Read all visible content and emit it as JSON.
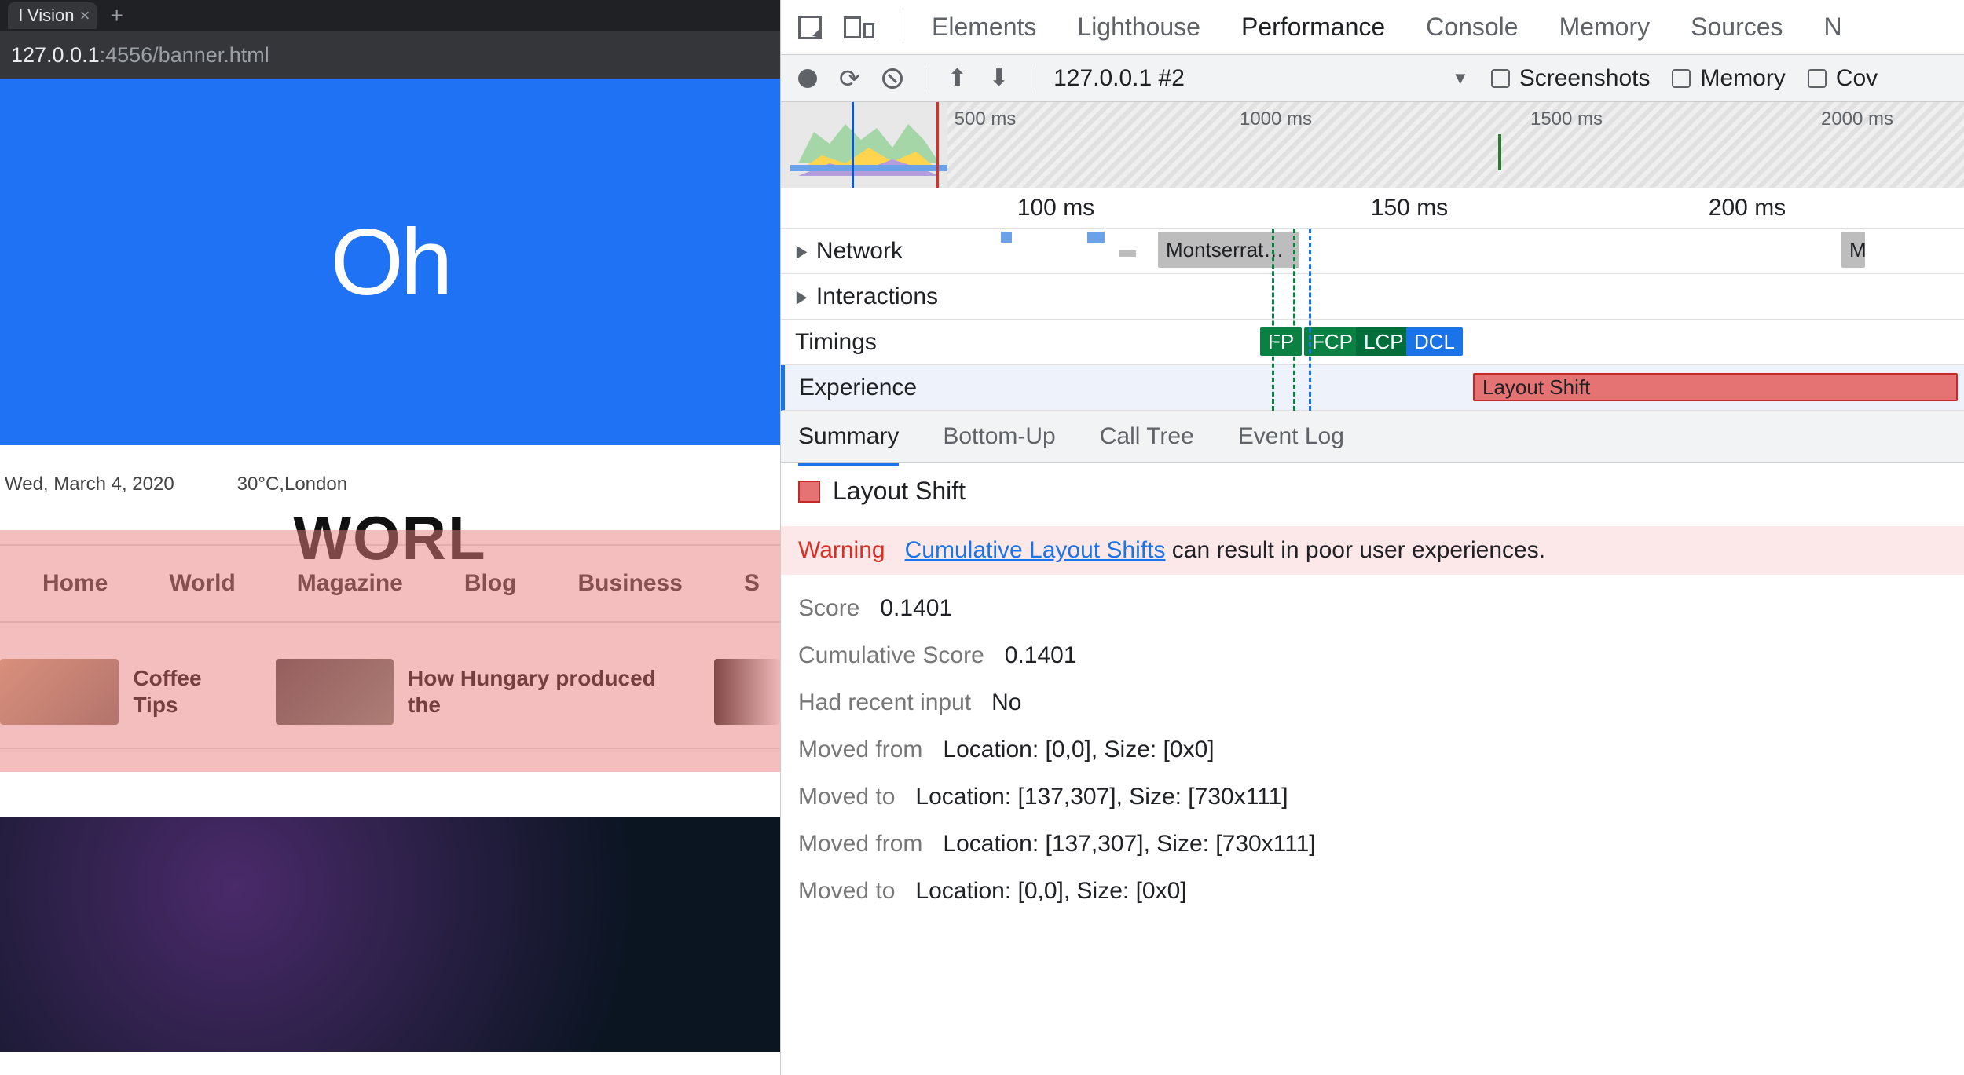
{
  "browser": {
    "tab_title": "l Vision",
    "url_host": "127.0.0.1",
    "url_rest": ":4556/banner.html"
  },
  "page": {
    "banner_text": "Oh",
    "date": "Wed, March 4, 2020",
    "weather": "30°C,London",
    "site_title": "WORL",
    "nav": [
      "Home",
      "World",
      "Magazine",
      "Blog",
      "Business",
      "S"
    ],
    "stories": [
      {
        "title": "Coffee Tips"
      },
      {
        "title": "How Hungary produced the"
      }
    ]
  },
  "devtools": {
    "tabs": [
      "Elements",
      "Lighthouse",
      "Performance",
      "Console",
      "Memory",
      "Sources",
      "N"
    ],
    "active_tab": "Performance",
    "toolbar": {
      "recording_select": "127.0.0.1 #2",
      "screenshots": "Screenshots",
      "memory": "Memory",
      "cov": "Cov"
    },
    "overview_ticks": [
      "500 ms",
      "1000 ms",
      "1500 ms",
      "2000 ms"
    ],
    "ruler_ticks": [
      "100 ms",
      "150 ms",
      "200 ms"
    ],
    "tracks": {
      "network": "Network",
      "network_chip": "Montserrat…",
      "network_chip2": "M",
      "interactions": "Interactions",
      "timings": "Timings",
      "timings_markers": {
        "fp": "FP",
        "fcp": "FCP",
        "lcp": "LCP",
        "dcl": "DCL"
      },
      "experience": "Experience",
      "experience_chip": "Layout Shift"
    },
    "subtabs": [
      "Summary",
      "Bottom-Up",
      "Call Tree",
      "Event Log"
    ],
    "active_subtab": "Summary",
    "detail": {
      "title": "Layout Shift",
      "warning_label": "Warning",
      "warning_link": "Cumulative Layout Shifts",
      "warning_rest": " can result in poor user experiences.",
      "rows": [
        {
          "k": "Score",
          "v": "0.1401"
        },
        {
          "k": "Cumulative Score",
          "v": "0.1401"
        },
        {
          "k": "Had recent input",
          "v": "No"
        },
        {
          "k": "Moved from",
          "v": "Location: [0,0], Size: [0x0]"
        },
        {
          "k": "Moved to",
          "v": "Location: [137,307], Size: [730x111]"
        },
        {
          "k": "Moved from",
          "v": "Location: [137,307], Size: [730x111]"
        },
        {
          "k": "Moved to",
          "v": "Location: [0,0], Size: [0x0]"
        }
      ]
    }
  }
}
